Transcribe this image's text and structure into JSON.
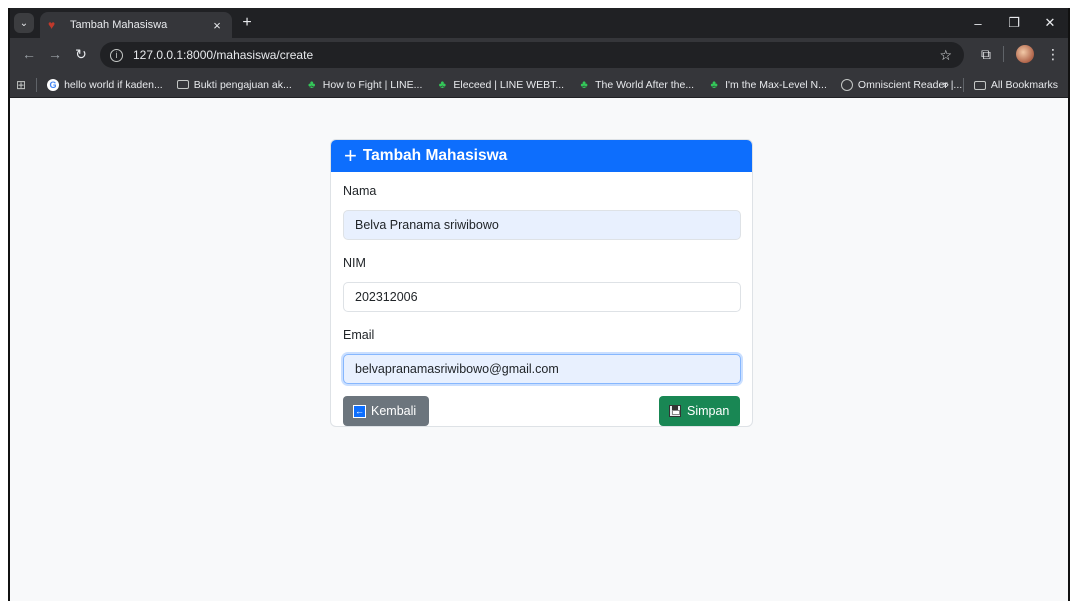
{
  "browser": {
    "tab": {
      "title": "Tambah Mahasiswa",
      "close": "×"
    },
    "new_tab": "+",
    "url": "127.0.0.1:8000/mahasiswa/create",
    "bookmarks": [
      {
        "label": "hello world if kaden...",
        "icon": "google-icon"
      },
      {
        "label": "Bukti pengajuan ak...",
        "icon": "folder-icon"
      },
      {
        "label": "How to Fight | LINE...",
        "icon": "webtoon-icon"
      },
      {
        "label": "Eleceed | LINE WEBT...",
        "icon": "webtoon-icon"
      },
      {
        "label": "The World After the...",
        "icon": "webtoon-icon"
      },
      {
        "label": "I'm the Max-Level N...",
        "icon": "webtoon-icon"
      },
      {
        "label": "Omniscient Reader |...",
        "icon": "globe-icon"
      }
    ],
    "bookmarks_more": "»",
    "all_bookmarks": "All Bookmarks"
  },
  "form": {
    "title": "Tambah Mahasiswa",
    "fields": {
      "nama": {
        "label": "Nama",
        "value": "Belva Pranama sriwibowo"
      },
      "nim": {
        "label": "NIM",
        "value": "202312006"
      },
      "email": {
        "label": "Email",
        "value": "belvapranamasriwibowo@gmail.com"
      }
    },
    "back_label": "Kembali",
    "save_label": "Simpan"
  },
  "colors": {
    "primary": "#0d6efd",
    "secondary": "#6c757d",
    "success": "#198754"
  }
}
